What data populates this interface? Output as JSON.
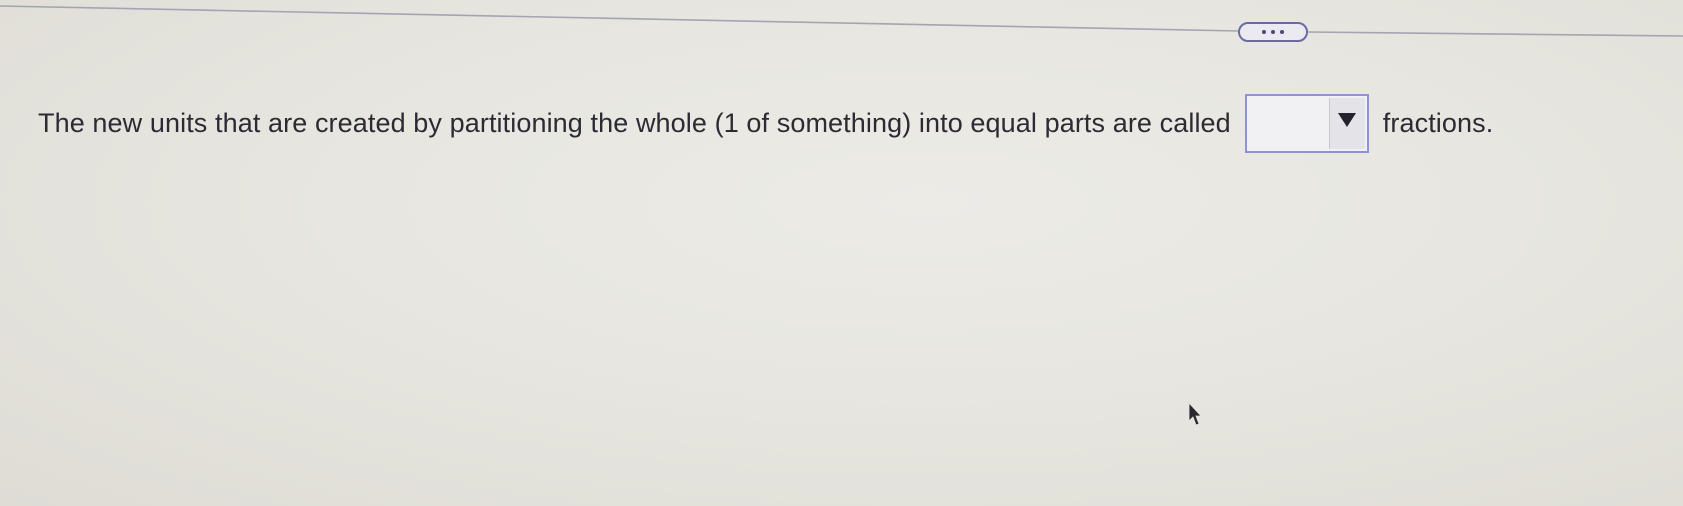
{
  "toolbar": {
    "more_icon": "ellipsis-icon"
  },
  "question": {
    "text_before": "The new units that are created by partitioning the whole (1 of something) into equal parts are called",
    "select": {
      "selected_value": "",
      "icon": "dropdown-triangle-icon"
    },
    "text_after": "fractions."
  },
  "colors": {
    "background": "#e7e6e0",
    "text": "#2c2a33",
    "accent_border": "#8f93cf",
    "more_button_border": "#6b6aa6"
  }
}
